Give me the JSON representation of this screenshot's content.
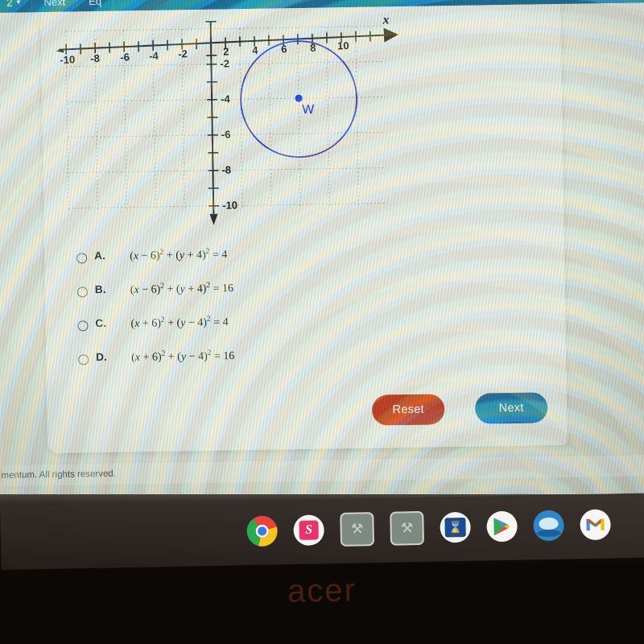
{
  "appbar": {
    "page_number": "2",
    "chevron": "chevron-down-icon",
    "item_next": "Next",
    "item_trunc": "Eq"
  },
  "graph": {
    "x_axis_label": "x",
    "x_ticks": [
      "-10",
      "-8",
      "-6",
      "-4",
      "-2",
      "2",
      "4",
      "6",
      "8",
      "10"
    ],
    "y_ticks": [
      "-2",
      "-4",
      "-6",
      "-8",
      "-10"
    ],
    "point_label": "W",
    "circle": {
      "center_x": 6,
      "center_y": -4,
      "radius": 4
    },
    "axis_color": "#2f2f2f",
    "circle_color": "#3b3fb0",
    "point_color": "#1b2fd8",
    "grid_color": "#9aa396"
  },
  "chart_data": {
    "type": "scatter",
    "title": "",
    "xlabel": "x",
    "ylabel": "",
    "xlim": [
      -11,
      11
    ],
    "ylim": [
      -11,
      1
    ],
    "grid": true,
    "x_tick_labels": [
      "-10",
      "-8",
      "-6",
      "-4",
      "-2",
      "2",
      "4",
      "6",
      "8",
      "10"
    ],
    "x_tick_values": [
      -10,
      -8,
      -6,
      -4,
      -2,
      2,
      4,
      6,
      8,
      10
    ],
    "y_tick_labels": [
      "-2",
      "-4",
      "-6",
      "-8",
      "-10"
    ],
    "y_tick_values": [
      -2,
      -4,
      -6,
      -8,
      -10
    ],
    "annotations": [
      {
        "label": "W",
        "x": 6,
        "y": -4,
        "type": "point"
      }
    ],
    "shapes": [
      {
        "type": "circle",
        "cx": 6,
        "cy": -4,
        "r": 4,
        "stroke": "#3b3fb0",
        "fill": "none"
      }
    ]
  },
  "options": [
    {
      "letter": "A.",
      "selected": false,
      "equation_html": "(<i>x</i> &#8722; 6)<sup>2</sup> + (<i>y</i> + 4)<sup>2</sup> = 4",
      "equation_text": "(x - 6)^2 + (y + 4)^2 = 4"
    },
    {
      "letter": "B.",
      "selected": false,
      "equation_html": "(<i>x</i> &#8722; 6)<sup>2</sup> + (<i>y</i> + 4)<sup>2</sup> = 16",
      "equation_text": "(x - 6)^2 + (y + 4)^2 = 16"
    },
    {
      "letter": "C.",
      "selected": false,
      "equation_html": "(<i>x</i> + 6)<sup>2</sup> + (<i>y</i> &#8722; 4)<sup>2</sup> = 4",
      "equation_text": "(x + 6)^2 + (y - 4)^2 = 4"
    },
    {
      "letter": "D.",
      "selected": false,
      "equation_html": "(<i>x</i> + 6)<sup>2</sup> + (<i>y</i> &#8722; 4)<sup>2</sup> = 16",
      "equation_text": "(x + 6)^2 + (y - 4)^2 = 16"
    }
  ],
  "buttons": {
    "reset_label": "Reset",
    "next_label": "Next",
    "reset_color": "#bd4226",
    "next_color": "#2a6f9c"
  },
  "footer": {
    "copyright": "mentum. All rights reserved."
  },
  "taskbar": {
    "items": [
      {
        "name": "chrome-icon",
        "label": "Chrome"
      },
      {
        "name": "s-app-icon",
        "label": "S"
      },
      {
        "name": "app-grey-1-icon",
        "label": ""
      },
      {
        "name": "app-grey-2-icon",
        "label": ""
      },
      {
        "name": "blue-app-icon",
        "label": ""
      },
      {
        "name": "google-play-icon",
        "label": ""
      },
      {
        "name": "whale-app-icon",
        "label": ""
      },
      {
        "name": "gmail-icon",
        "label": ""
      }
    ]
  },
  "laptop": {
    "brand": "acer"
  }
}
